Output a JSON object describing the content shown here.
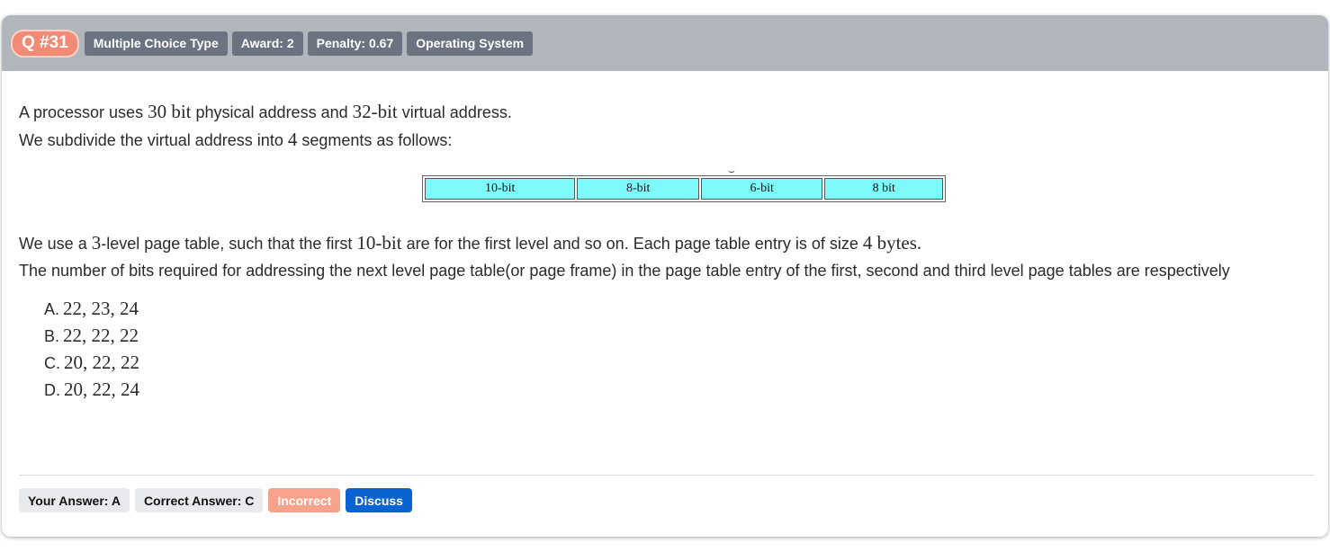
{
  "header": {
    "qnum": "Q #31",
    "tags": [
      "Multiple Choice Type",
      "Award: 2",
      "Penalty: 0.67",
      "Operating System"
    ]
  },
  "question": {
    "line1": {
      "a": "A processor uses ",
      "b": "30 bit",
      "c": " physical address and ",
      "d": "32-bit",
      "e": " virtual address."
    },
    "line2": {
      "a": "We subdivide the virtual address into ",
      "b": "4",
      "c": " segments as follows:"
    },
    "segments": [
      "10-bit",
      "8-bit",
      "6-bit",
      "8 bit"
    ],
    "segment_tick": "⌣",
    "line3": {
      "a": "We use a ",
      "b": "3",
      "c": "-level page table, such that the first ",
      "d": "10-bit",
      "e": " are for the first level and so on. Each page table entry is of size ",
      "f": "4 bytes."
    },
    "line4": "The number of bits required for addressing the next level page table(or page frame) in the page table entry of the first, second and third level page tables are respectively"
  },
  "options": [
    {
      "letter": "A.",
      "value": "22, 23, 24"
    },
    {
      "letter": "B.",
      "value": "22, 22, 22"
    },
    {
      "letter": "C.",
      "value": "20, 22, 22"
    },
    {
      "letter": "D.",
      "value": "20, 22, 24"
    }
  ],
  "footer": {
    "your_answer": "Your Answer: A",
    "correct_answer": "Correct Answer: C",
    "status": "Incorrect",
    "discuss": "Discuss"
  },
  "colors": {
    "header_bg": "#b1b5bc",
    "qnum_bg": "#f28b75",
    "tag_bg": "#6b7380",
    "segment_fill": "#7ffafa",
    "incorrect_bg": "#f7a28a",
    "discuss_bg": "#0b63d1"
  }
}
